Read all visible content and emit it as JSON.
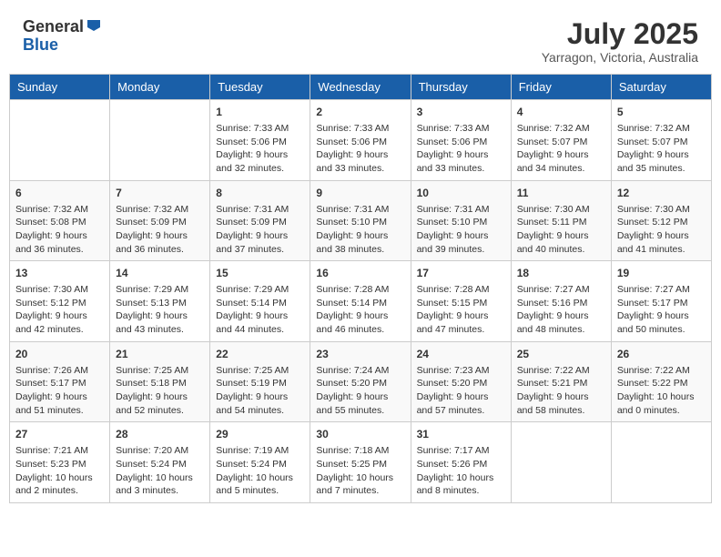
{
  "header": {
    "logo_general": "General",
    "logo_blue": "Blue",
    "month_year": "July 2025",
    "location": "Yarragon, Victoria, Australia"
  },
  "days_of_week": [
    "Sunday",
    "Monday",
    "Tuesday",
    "Wednesday",
    "Thursday",
    "Friday",
    "Saturday"
  ],
  "weeks": [
    [
      {
        "day": "",
        "content": ""
      },
      {
        "day": "",
        "content": ""
      },
      {
        "day": "1",
        "content": "Sunrise: 7:33 AM\nSunset: 5:06 PM\nDaylight: 9 hours\nand 32 minutes."
      },
      {
        "day": "2",
        "content": "Sunrise: 7:33 AM\nSunset: 5:06 PM\nDaylight: 9 hours\nand 33 minutes."
      },
      {
        "day": "3",
        "content": "Sunrise: 7:33 AM\nSunset: 5:06 PM\nDaylight: 9 hours\nand 33 minutes."
      },
      {
        "day": "4",
        "content": "Sunrise: 7:32 AM\nSunset: 5:07 PM\nDaylight: 9 hours\nand 34 minutes."
      },
      {
        "day": "5",
        "content": "Sunrise: 7:32 AM\nSunset: 5:07 PM\nDaylight: 9 hours\nand 35 minutes."
      }
    ],
    [
      {
        "day": "6",
        "content": "Sunrise: 7:32 AM\nSunset: 5:08 PM\nDaylight: 9 hours\nand 36 minutes."
      },
      {
        "day": "7",
        "content": "Sunrise: 7:32 AM\nSunset: 5:09 PM\nDaylight: 9 hours\nand 36 minutes."
      },
      {
        "day": "8",
        "content": "Sunrise: 7:31 AM\nSunset: 5:09 PM\nDaylight: 9 hours\nand 37 minutes."
      },
      {
        "day": "9",
        "content": "Sunrise: 7:31 AM\nSunset: 5:10 PM\nDaylight: 9 hours\nand 38 minutes."
      },
      {
        "day": "10",
        "content": "Sunrise: 7:31 AM\nSunset: 5:10 PM\nDaylight: 9 hours\nand 39 minutes."
      },
      {
        "day": "11",
        "content": "Sunrise: 7:30 AM\nSunset: 5:11 PM\nDaylight: 9 hours\nand 40 minutes."
      },
      {
        "day": "12",
        "content": "Sunrise: 7:30 AM\nSunset: 5:12 PM\nDaylight: 9 hours\nand 41 minutes."
      }
    ],
    [
      {
        "day": "13",
        "content": "Sunrise: 7:30 AM\nSunset: 5:12 PM\nDaylight: 9 hours\nand 42 minutes."
      },
      {
        "day": "14",
        "content": "Sunrise: 7:29 AM\nSunset: 5:13 PM\nDaylight: 9 hours\nand 43 minutes."
      },
      {
        "day": "15",
        "content": "Sunrise: 7:29 AM\nSunset: 5:14 PM\nDaylight: 9 hours\nand 44 minutes."
      },
      {
        "day": "16",
        "content": "Sunrise: 7:28 AM\nSunset: 5:14 PM\nDaylight: 9 hours\nand 46 minutes."
      },
      {
        "day": "17",
        "content": "Sunrise: 7:28 AM\nSunset: 5:15 PM\nDaylight: 9 hours\nand 47 minutes."
      },
      {
        "day": "18",
        "content": "Sunrise: 7:27 AM\nSunset: 5:16 PM\nDaylight: 9 hours\nand 48 minutes."
      },
      {
        "day": "19",
        "content": "Sunrise: 7:27 AM\nSunset: 5:17 PM\nDaylight: 9 hours\nand 50 minutes."
      }
    ],
    [
      {
        "day": "20",
        "content": "Sunrise: 7:26 AM\nSunset: 5:17 PM\nDaylight: 9 hours\nand 51 minutes."
      },
      {
        "day": "21",
        "content": "Sunrise: 7:25 AM\nSunset: 5:18 PM\nDaylight: 9 hours\nand 52 minutes."
      },
      {
        "day": "22",
        "content": "Sunrise: 7:25 AM\nSunset: 5:19 PM\nDaylight: 9 hours\nand 54 minutes."
      },
      {
        "day": "23",
        "content": "Sunrise: 7:24 AM\nSunset: 5:20 PM\nDaylight: 9 hours\nand 55 minutes."
      },
      {
        "day": "24",
        "content": "Sunrise: 7:23 AM\nSunset: 5:20 PM\nDaylight: 9 hours\nand 57 minutes."
      },
      {
        "day": "25",
        "content": "Sunrise: 7:22 AM\nSunset: 5:21 PM\nDaylight: 9 hours\nand 58 minutes."
      },
      {
        "day": "26",
        "content": "Sunrise: 7:22 AM\nSunset: 5:22 PM\nDaylight: 10 hours\nand 0 minutes."
      }
    ],
    [
      {
        "day": "27",
        "content": "Sunrise: 7:21 AM\nSunset: 5:23 PM\nDaylight: 10 hours\nand 2 minutes."
      },
      {
        "day": "28",
        "content": "Sunrise: 7:20 AM\nSunset: 5:24 PM\nDaylight: 10 hours\nand 3 minutes."
      },
      {
        "day": "29",
        "content": "Sunrise: 7:19 AM\nSunset: 5:24 PM\nDaylight: 10 hours\nand 5 minutes."
      },
      {
        "day": "30",
        "content": "Sunrise: 7:18 AM\nSunset: 5:25 PM\nDaylight: 10 hours\nand 7 minutes."
      },
      {
        "day": "31",
        "content": "Sunrise: 7:17 AM\nSunset: 5:26 PM\nDaylight: 10 hours\nand 8 minutes."
      },
      {
        "day": "",
        "content": ""
      },
      {
        "day": "",
        "content": ""
      }
    ]
  ]
}
